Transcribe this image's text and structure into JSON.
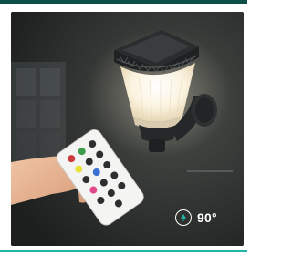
{
  "product_image": {
    "rotation_badge": {
      "icon": "rotate-icon",
      "label": "90°"
    }
  },
  "colors": {
    "top_bar": "#0f4f4a",
    "bottom_accent": "#1fb6a8"
  }
}
